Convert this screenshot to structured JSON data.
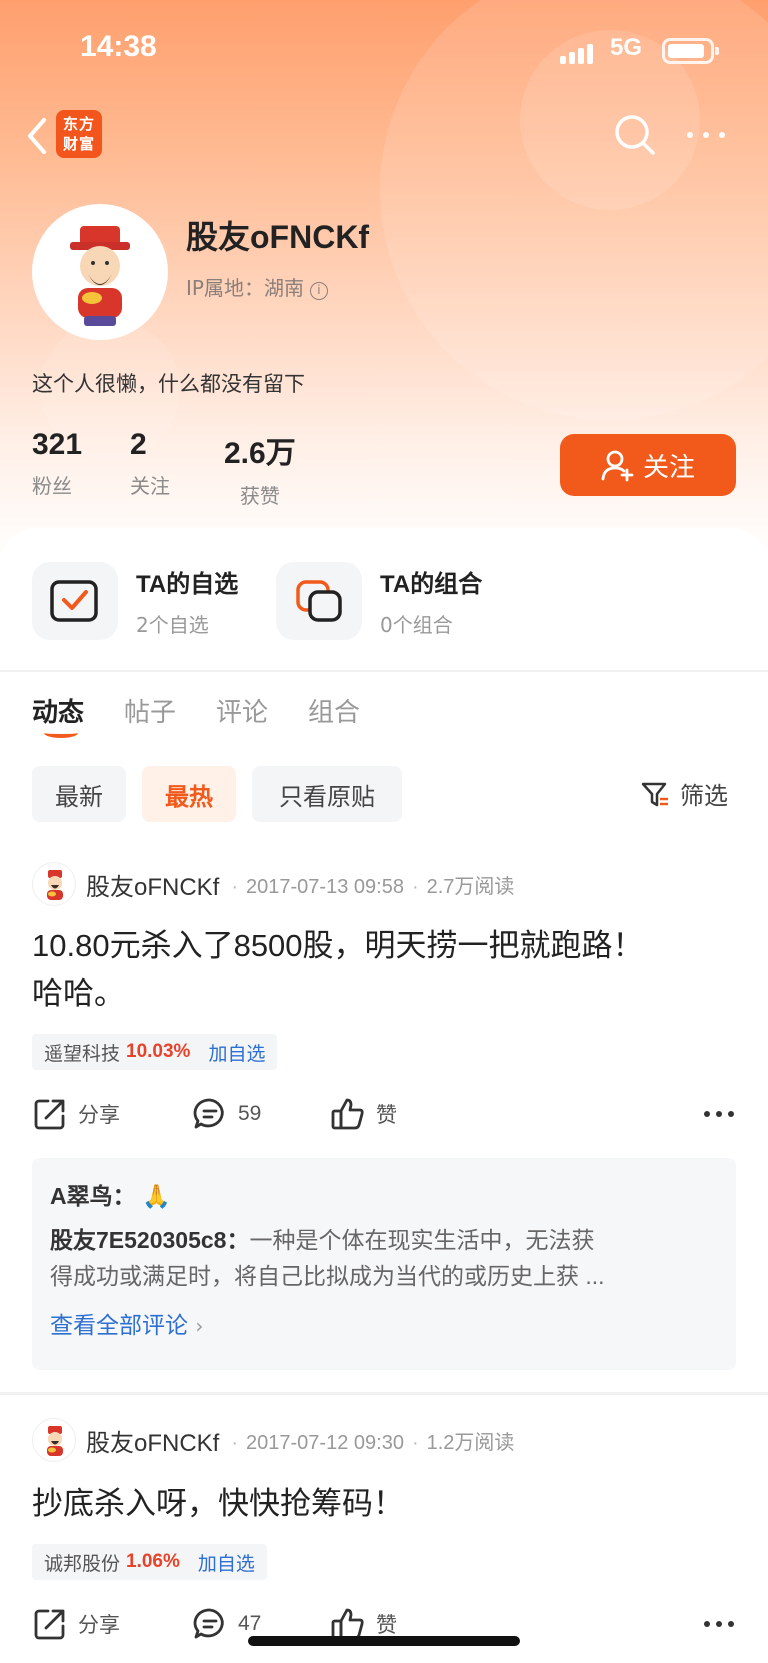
{
  "status_bar": {
    "time": "14:38",
    "network": "5G"
  },
  "nav": {
    "logo_text": "东方财富"
  },
  "profile": {
    "nickname": "股友oFNCKf",
    "ip_location": "IP属地：湖南",
    "bio": "这个人很懒，什么都没有留下",
    "stats": [
      {
        "value": "321",
        "label": "粉丝"
      },
      {
        "value": "2",
        "label": "关注"
      },
      {
        "value": "2.6万",
        "label": "获赞"
      }
    ],
    "follow_label": "关注"
  },
  "shortcuts": [
    {
      "title": "TA的自选",
      "subtitle": "2个自选"
    },
    {
      "title": "TA的组合",
      "subtitle": "0个组合"
    }
  ],
  "tabs": [
    "动态",
    "帖子",
    "评论",
    "组合"
  ],
  "active_tab": "动态",
  "filters": [
    "最新",
    "最热",
    "只看原贴"
  ],
  "active_filter": "最热",
  "sort_label": "筛选",
  "posts": [
    {
      "author": "股友oFNCKf",
      "date": "2017-07-13 09:58",
      "reads": "2.7万阅读",
      "body_line1": "10.80元杀入了8500股，明天捞一把就跑路！",
      "body_line2": "哈哈。",
      "stock_name": "遥望科技",
      "stock_change": "10.03%",
      "add_watch": "加自选",
      "share_label": "分享",
      "comment_count": "59",
      "like_label": "赞",
      "comments": [
        {
          "name": "A翠鸟：",
          "text": "🙏"
        },
        {
          "name": "股友7E520305c8：",
          "text": "一种是个体在现实生活中，无法获",
          "text2": "得成功或满足时，将自己比拟成为当代的或历史上获 ..."
        }
      ],
      "view_all": "查看全部评论"
    },
    {
      "author": "股友oFNCKf",
      "date": "2017-07-12 09:30",
      "reads": "1.2万阅读",
      "body_line1": "抄底杀入呀，快快抢筹码！",
      "stock_name": "诚邦股份",
      "stock_change": "1.06%",
      "add_watch": "加自选",
      "share_label": "分享",
      "comment_count": "47",
      "like_label": "赞"
    }
  ],
  "colors": {
    "accent": "#f25a1c",
    "link": "#2e6fd2",
    "rise": "#e8422a"
  }
}
